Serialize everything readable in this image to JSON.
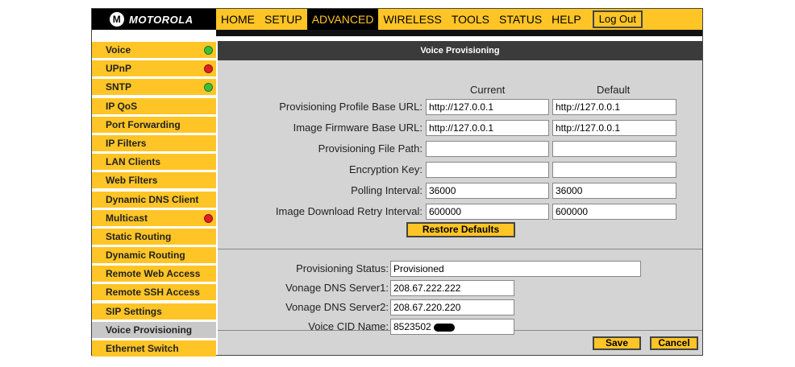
{
  "brand": {
    "name": "MOTOROLA",
    "logo_glyph": "M"
  },
  "nav": {
    "tabs": [
      "HOME",
      "SETUP",
      "ADVANCED",
      "WIRELESS",
      "TOOLS",
      "STATUS",
      "HELP"
    ],
    "active": "ADVANCED",
    "logout_label": "Log Out"
  },
  "sidebar": {
    "items": [
      {
        "label": "Voice",
        "status": "green"
      },
      {
        "label": "UPnP",
        "status": "red"
      },
      {
        "label": "SNTP",
        "status": "green"
      },
      {
        "label": "IP QoS"
      },
      {
        "label": "Port Forwarding"
      },
      {
        "label": "IP Filters"
      },
      {
        "label": "LAN Clients"
      },
      {
        "label": "Web Filters"
      },
      {
        "label": "Dynamic DNS Client"
      },
      {
        "label": "Multicast",
        "status": "red"
      },
      {
        "label": "Static Routing"
      },
      {
        "label": "Dynamic Routing"
      },
      {
        "label": "Remote Web Access"
      },
      {
        "label": "Remote SSH Access"
      },
      {
        "label": "SIP Settings"
      },
      {
        "label": "Voice Provisioning",
        "active": true
      },
      {
        "label": "Ethernet Switch"
      }
    ]
  },
  "page": {
    "title": "Voice Provisioning"
  },
  "columns": {
    "current": "Current",
    "default": "Default"
  },
  "fields": [
    {
      "label": "Provisioning Profile Base URL:",
      "current": "http://127.0.0.1",
      "default": "http://127.0.0.1"
    },
    {
      "label": "Image Firmware Base URL:",
      "current": "http://127.0.0.1",
      "default": "http://127.0.0.1"
    },
    {
      "label": "Provisioning File Path:",
      "current": "",
      "default": ""
    },
    {
      "label": "Encryption Key:",
      "current": "",
      "default": ""
    },
    {
      "label": "Polling Interval:",
      "current": "36000",
      "default": "36000"
    },
    {
      "label": "Image Download Retry Interval:",
      "current": "600000",
      "default": "600000"
    }
  ],
  "restore_label": "Restore Defaults",
  "status_fields": [
    {
      "label": "Provisioning Status:",
      "value": "Provisioned"
    },
    {
      "label": "Vonage DNS Server1:",
      "value": "208.67.222.222"
    },
    {
      "label": "Vonage DNS Server2:",
      "value": "208.67.220.220"
    },
    {
      "label": "Voice CID Name:",
      "value": "8523502"
    }
  ],
  "save_label": "Save",
  "cancel_label": "Cancel",
  "colors": {
    "accent": "#ffc526",
    "dark": "#3b3b3b",
    "panel": "#d4d4d4"
  }
}
